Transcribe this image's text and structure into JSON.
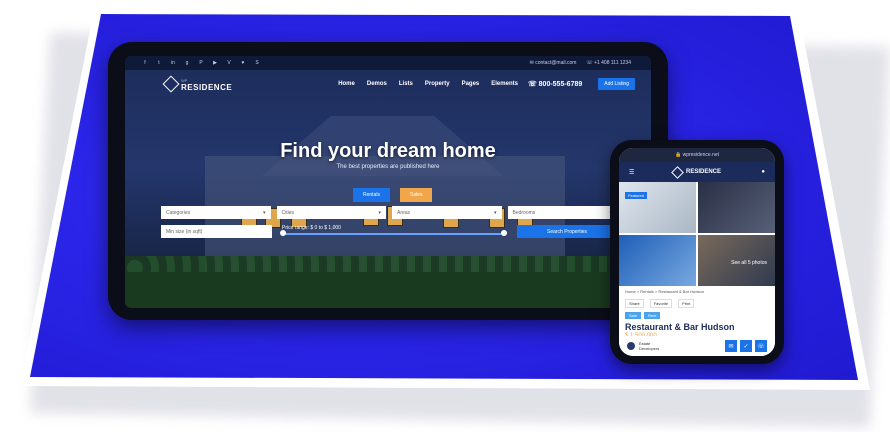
{
  "tablet": {
    "topbar": {
      "social_icons": [
        "f",
        "t",
        "in",
        "g",
        "P",
        "▶",
        "V",
        "♥",
        "S"
      ],
      "email": "✉ contact@mail.com",
      "phone": "☏ +1 408 111 1234"
    },
    "nav": {
      "logo_small": "WP",
      "logo_main": "RESIDENCE",
      "menu": [
        "Home",
        "Demos",
        "Lists",
        "Property",
        "Pages",
        "Elements"
      ],
      "phone": "☏ 800-555-6789",
      "add_listing": "Add Listing"
    },
    "hero": {
      "title": "Find your dream home",
      "subtitle": "The best properties are published here"
    },
    "tabs": {
      "rentals": "Rentals",
      "sales": "Sales"
    },
    "filters": {
      "categories": "Categories",
      "cities": "Cities",
      "areas": "Areas",
      "bedrooms": "Bedrooms",
      "min_size_placeholder": "Min size (in sqft)",
      "price_range": "Price range: $ 0 to $ 1,000",
      "search_button": "Search Properties"
    }
  },
  "phone": {
    "url": "🔒 wpresidence.net",
    "logo_small": "WP",
    "logo_main": "RESIDENCE",
    "gallery": {
      "badge": "Featured",
      "caption": "See all 5 photos"
    },
    "breadcrumb": "Home > Rentals > Restaurant & Bar Hudson",
    "actions": [
      "Share",
      "Favorite",
      "Print"
    ],
    "tags": [
      "Sale",
      "Rent"
    ],
    "title": "Restaurant & Bar Hudson",
    "price": "$ 1,500,000",
    "agent": {
      "line1": "Estate",
      "line2": "Developers"
    },
    "buttons": [
      "✉",
      "✓",
      "☏"
    ]
  },
  "colors": {
    "accent": "#1a73e8",
    "background": "#2a24e8",
    "sales_tab": "#f2a64a"
  }
}
